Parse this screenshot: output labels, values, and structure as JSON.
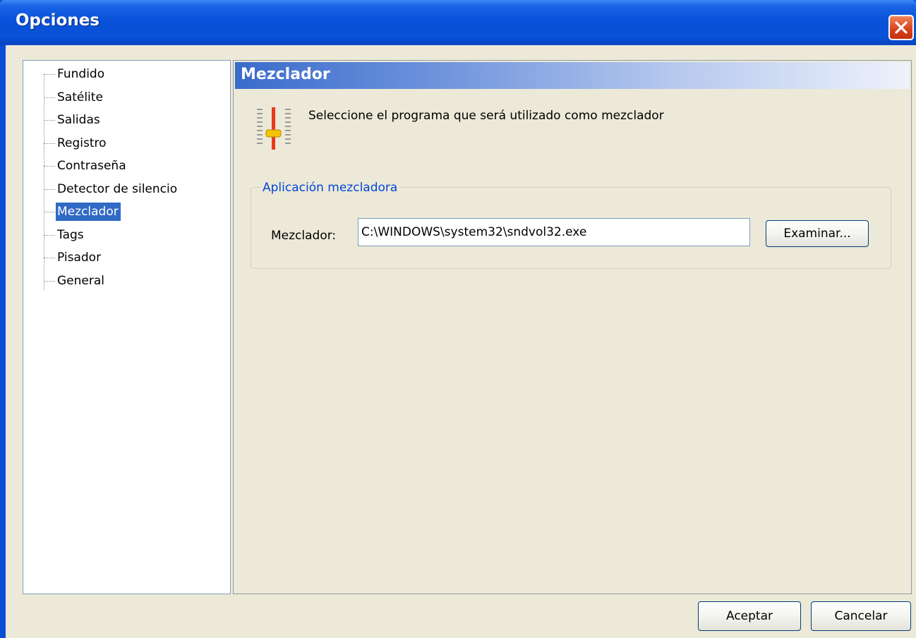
{
  "window": {
    "title": "Opciones",
    "close_icon": "close-icon"
  },
  "tree": {
    "items": [
      {
        "label": "Fundido"
      },
      {
        "label": "Satélite"
      },
      {
        "label": "Salidas"
      },
      {
        "label": "Registro"
      },
      {
        "label": "Contraseña"
      },
      {
        "label": "Detector de silencio"
      },
      {
        "label": "Mezclador",
        "selected": true
      },
      {
        "label": "Tags"
      },
      {
        "label": "Pisador"
      },
      {
        "label": "General"
      }
    ]
  },
  "panel": {
    "header": "Mezclador",
    "icon": "mixer-slider-icon",
    "intro": "Seleccione el programa que será utilizado como mezclador",
    "group": {
      "legend": "Aplicación mezcladora",
      "field_label": "Mezclador:",
      "path_value": "C:\\WINDOWS\\system32\\sndvol32.exe",
      "browse_label": "Examinar..."
    }
  },
  "buttons": {
    "accept": "Aceptar",
    "cancel": "Cancelar"
  },
  "colors": {
    "titlebar": "#0a52d8",
    "selection": "#316ac5",
    "group_legend": "#0046d5",
    "dialog_bg": "#ece9d8"
  }
}
